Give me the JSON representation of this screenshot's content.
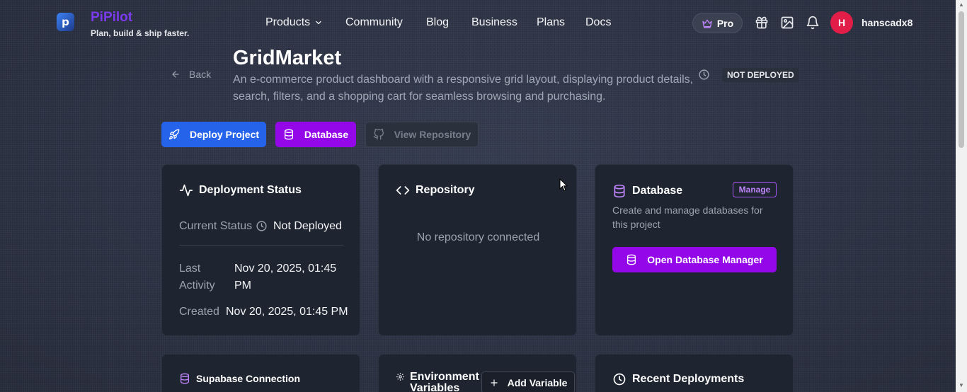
{
  "header": {
    "brand_name": "PiPilot",
    "brand_tagline": "Plan, build & ship faster.",
    "nav": [
      "Products",
      "Community",
      "Blog",
      "Business",
      "Plans",
      "Docs"
    ],
    "pro_label": "Pro",
    "avatar_initial": "H",
    "username": "hanscadx8"
  },
  "project": {
    "back_label": "Back",
    "title": "GridMarket",
    "description": "An e-commerce product dashboard with a responsive grid layout, displaying product details, search, filters, and a shopping cart for seamless browsing and purchasing.",
    "status_badge": "NOT DEPLOYED"
  },
  "actions": {
    "deploy": "Deploy Project",
    "database": "Database",
    "view_repo": "View Repository"
  },
  "cards": {
    "deployment": {
      "title": "Deployment Status",
      "current_status_label": "Current Status",
      "current_status_value": "Not Deployed",
      "last_activity_label_1": "Last",
      "last_activity_label_2": "Activity",
      "last_activity_value_1": "Nov 20, 2025, 01:45",
      "last_activity_value_2": "PM",
      "created_label": "Created",
      "created_value": "Nov 20, 2025, 01:45 PM"
    },
    "repository": {
      "title": "Repository",
      "empty": "No repository connected"
    },
    "database": {
      "title": "Database",
      "manage": "Manage",
      "desc_1": "Create and manage databases for",
      "desc_2": "this project",
      "open_button": "Open Database Manager"
    },
    "supabase": {
      "title": "Supabase Connection"
    },
    "env": {
      "title_1": "Environment",
      "title_2": "Variables",
      "add_button": "Add Variable"
    },
    "recent": {
      "title": "Recent Deployments"
    }
  },
  "colors": {
    "accent_blue": "#2563eb",
    "accent_purple": "#9307e8",
    "brand_purple": "#7c3aed",
    "avatar_red": "#e11d48"
  }
}
